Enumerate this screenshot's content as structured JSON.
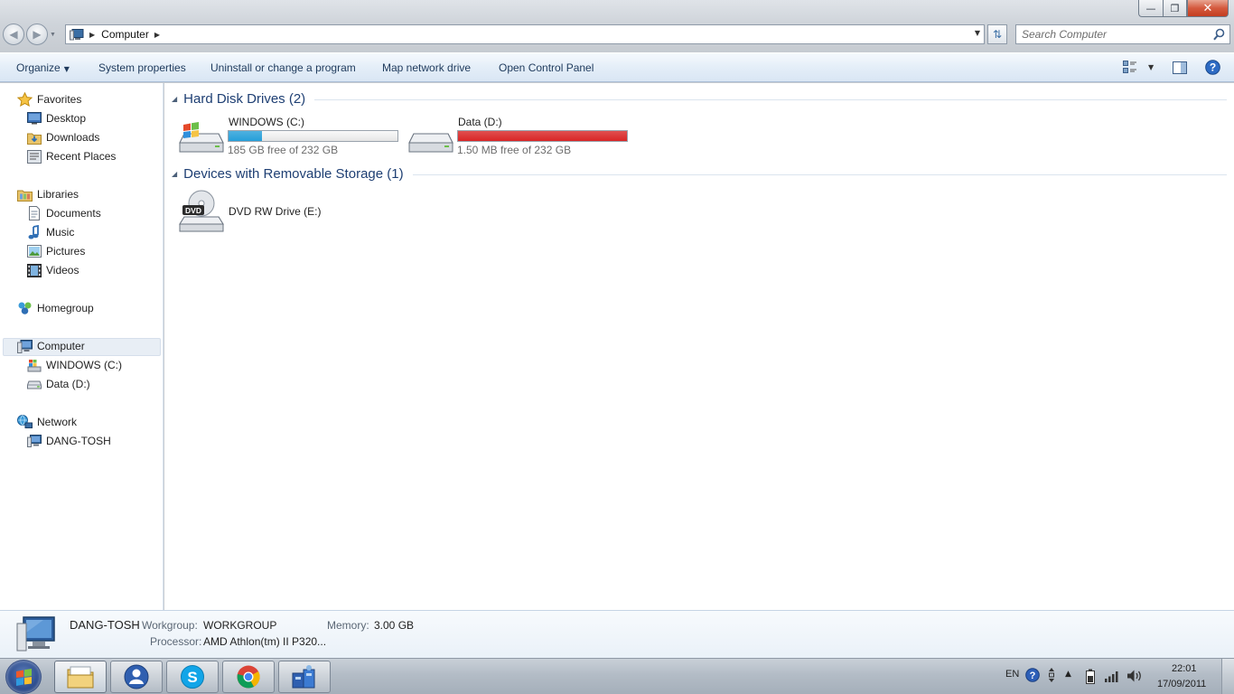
{
  "window": {
    "controls": {
      "minimize_icon": "minimize-icon",
      "maximize_icon": "maximize-icon",
      "close_icon": "close-icon"
    }
  },
  "address": {
    "location": "Computer",
    "search_placeholder": "Search Computer"
  },
  "toolbar": {
    "organize": "Organize",
    "system_properties": "System properties",
    "uninstall": "Uninstall or change a program",
    "map_network": "Map network drive",
    "open_control_panel": "Open Control Panel"
  },
  "nav": {
    "favorites": {
      "label": "Favorites",
      "items": [
        "Desktop",
        "Downloads",
        "Recent Places"
      ]
    },
    "libraries": {
      "label": "Libraries",
      "items": [
        "Documents",
        "Music",
        "Pictures",
        "Videos"
      ]
    },
    "homegroup": "Homegroup",
    "computer": {
      "label": "Computer",
      "items": [
        "WINDOWS (C:)",
        "Data (D:)"
      ]
    },
    "network": {
      "label": "Network",
      "items": [
        "DANG-TOSH"
      ]
    }
  },
  "groups": [
    {
      "title": "Hard Disk Drives (2)"
    },
    {
      "title": "Devices with Removable Storage (1)"
    }
  ],
  "drives": [
    {
      "name": "WINDOWS (C:)",
      "free": "185 GB free of 232 GB",
      "used_fraction": 0.2,
      "bar_color": "#26a0da"
    },
    {
      "name": "Data (D:)",
      "free": "1.50 MB free of 232 GB",
      "used_fraction": 1.0,
      "bar_color": "#da2626"
    }
  ],
  "removable": [
    {
      "name": "DVD RW Drive (E:)",
      "icon_label": "DVD"
    }
  ],
  "details": {
    "computer_name": "DANG-TOSH",
    "workgroup_label": "Workgroup:",
    "workgroup_value": "WORKGROUP",
    "memory_label": "Memory:",
    "memory_value": "3.00 GB",
    "processor_label": "Processor:",
    "processor_value": "AMD Athlon(tm) II P320..."
  },
  "taskbar": {
    "language": "EN",
    "time": "22:01",
    "date": "17/09/2011"
  }
}
